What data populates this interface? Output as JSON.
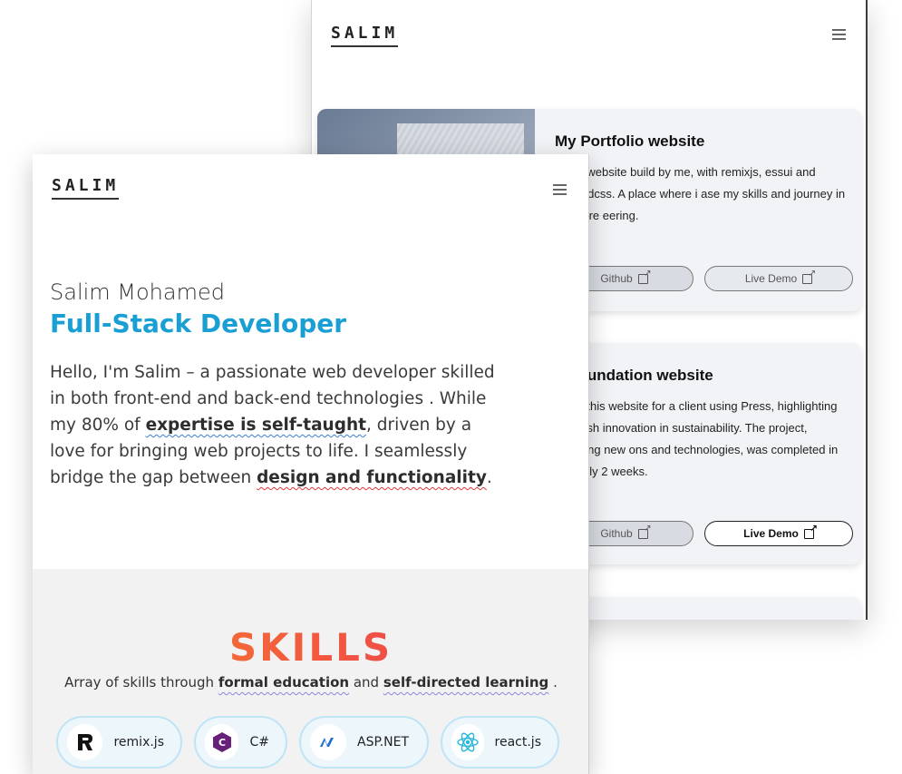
{
  "back_window": {
    "logo": "SALIM",
    "projects": [
      {
        "title": "My Portfolio website",
        "description": "rtfolio website build by me, with remixjs, essui and tailwindcss. A place where i ase my skills and journey in software eering.",
        "github_label": "Github",
        "live_label": "Live Demo"
      },
      {
        "title": "F Foundation website",
        "description": "loped this website for a client using Press, highlighting Swedish innovation in sustainability. The project, featuring new ons and technologies, was completed in ximately 2 weeks.",
        "github_label": "Github",
        "live_label": "Live Demo"
      }
    ]
  },
  "front_window": {
    "logo": "SALIM",
    "hero": {
      "name": "Salim Mohamed",
      "role": "Full-Stack Developer",
      "bio_part1": "Hello, I'm Salim – a passionate web developer skilled in both front-end and back-end technologies . While my 80% of ",
      "bio_hl1": "expertise is self-taught",
      "bio_part2": ", driven by a love for bringing web projects to life. I seamlessly bridge the gap between ",
      "bio_hl2": "design and functionality",
      "bio_part3": "."
    },
    "skills": {
      "title": "SKILLS",
      "sub_part1": "Array of skills through ",
      "sub_hl1": "formal education",
      "sub_part2": " and ",
      "sub_hl2": "self-directed learning",
      "sub_part3": " .",
      "items": [
        {
          "label": "remix.js",
          "icon": "remix-icon"
        },
        {
          "label": "C#",
          "icon": "csharp-icon"
        },
        {
          "label": "ASP.NET",
          "icon": "aspnet-icon"
        },
        {
          "label": "react.js",
          "icon": "react-icon"
        }
      ]
    }
  },
  "colors": {
    "accent_blue": "#1a9fd4",
    "skills_gradient_start": "#f28a2a",
    "skills_gradient_end": "#e8335a"
  }
}
